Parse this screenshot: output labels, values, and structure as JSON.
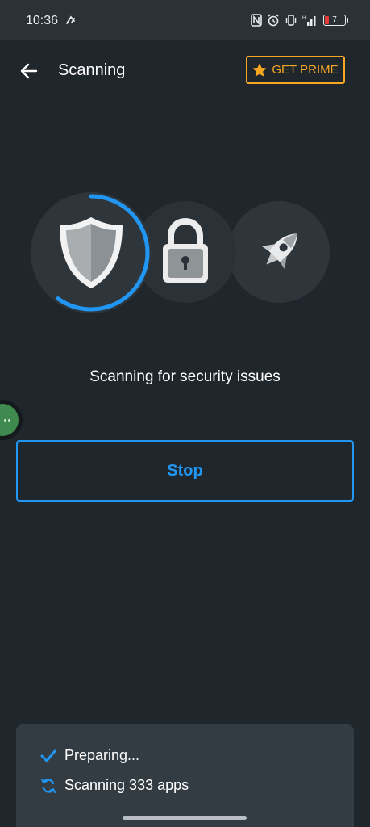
{
  "status_bar": {
    "time": "10:36",
    "battery_level": "7",
    "icons": [
      "app-notification-icon",
      "nfc-icon",
      "alarm-icon",
      "vibrate-icon",
      "signal-icon",
      "battery-icon"
    ],
    "battery_color": "#e53935"
  },
  "app_bar": {
    "title": "Scanning",
    "back_icon": "arrow-left-icon",
    "prime_label": "GET PRIME",
    "prime_icon": "star-icon",
    "prime_color": "#f5a623"
  },
  "scan": {
    "stages": [
      {
        "name": "security",
        "icon": "shield-icon",
        "active": true
      },
      {
        "name": "privacy",
        "icon": "lock-icon",
        "active": false
      },
      {
        "name": "performance",
        "icon": "rocket-icon",
        "active": false
      }
    ],
    "progress": 0.6,
    "status_text": "Scanning for security issues",
    "accent_color": "#2196f3"
  },
  "actions": {
    "stop_label": "Stop"
  },
  "progress_list": {
    "items": [
      {
        "label": "Preparing...",
        "icon": "checkmark-icon",
        "state": "done"
      },
      {
        "label": "Scanning 333 apps",
        "icon": "sync-icon",
        "state": "in-progress"
      }
    ]
  }
}
